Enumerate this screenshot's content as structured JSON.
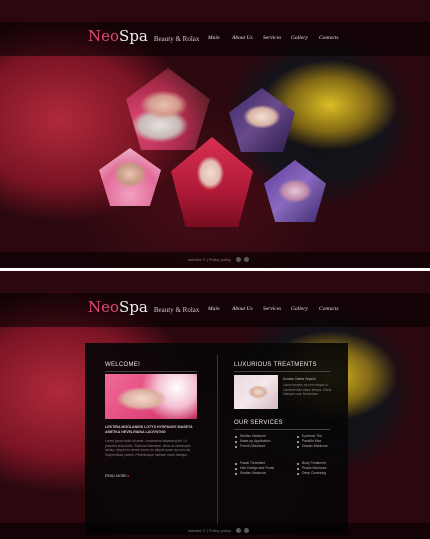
{
  "brand": {
    "logo_neo": "Neo",
    "logo_spa": "Spa",
    "tagline": "Beauty & Rolax"
  },
  "nav": {
    "items": [
      {
        "label": "Main"
      },
      {
        "label": "About Us"
      },
      {
        "label": "Services"
      },
      {
        "label": "Gallery"
      },
      {
        "label": "Contacts"
      }
    ]
  },
  "footer": {
    "text": "website © | Policy policy"
  },
  "welcome": {
    "title": "WELCOME!",
    "caps_text": "LEKTIRA MODLANEIS LOTYS HYSPANCE MASETA AMETKA NEVELRIANA LAOVNTNG",
    "body_text": "Lorem ipsum dolor sit amet, consectetur adipiscing elit. Ut pharetra nulla dolor. Vivamus bibendum, tellus at malesuada lacinia, neque leo ornare lorem, eu aliquet quam dui non nisi. Suspendisse potenti. Pellentesque habitant morbi tristique.",
    "read_more": "READ MORE"
  },
  "luxurious": {
    "title": "LUXURIOUS TREATMENTS",
    "subtitle": "Donitas Xotera Veyanti",
    "body_text": "Lacus tempus ea eum eaque id condimentum etiam tempor. Morbi tristique nunc fermentum."
  },
  "services": {
    "title": "OUR SERVICES",
    "col1": [
      "Shellac Manicure",
      "Make-up Application",
      "French Manicure",
      "Facial Treatment",
      "Hair Design and Finish",
      "Shellac Manicure"
    ],
    "col2": [
      "Eyebrow Tint",
      "Paraffin Wax",
      "Classic Manicure",
      "Body Treatment",
      "Pearls Manicure",
      "Deep Cleansing"
    ]
  },
  "colors": {
    "accent_pink": "#e24a78",
    "background_dark": "#1a0a0c",
    "panel_dark": "#080608"
  },
  "icons": [
    "social-icon-twitter",
    "social-icon-facebook"
  ]
}
